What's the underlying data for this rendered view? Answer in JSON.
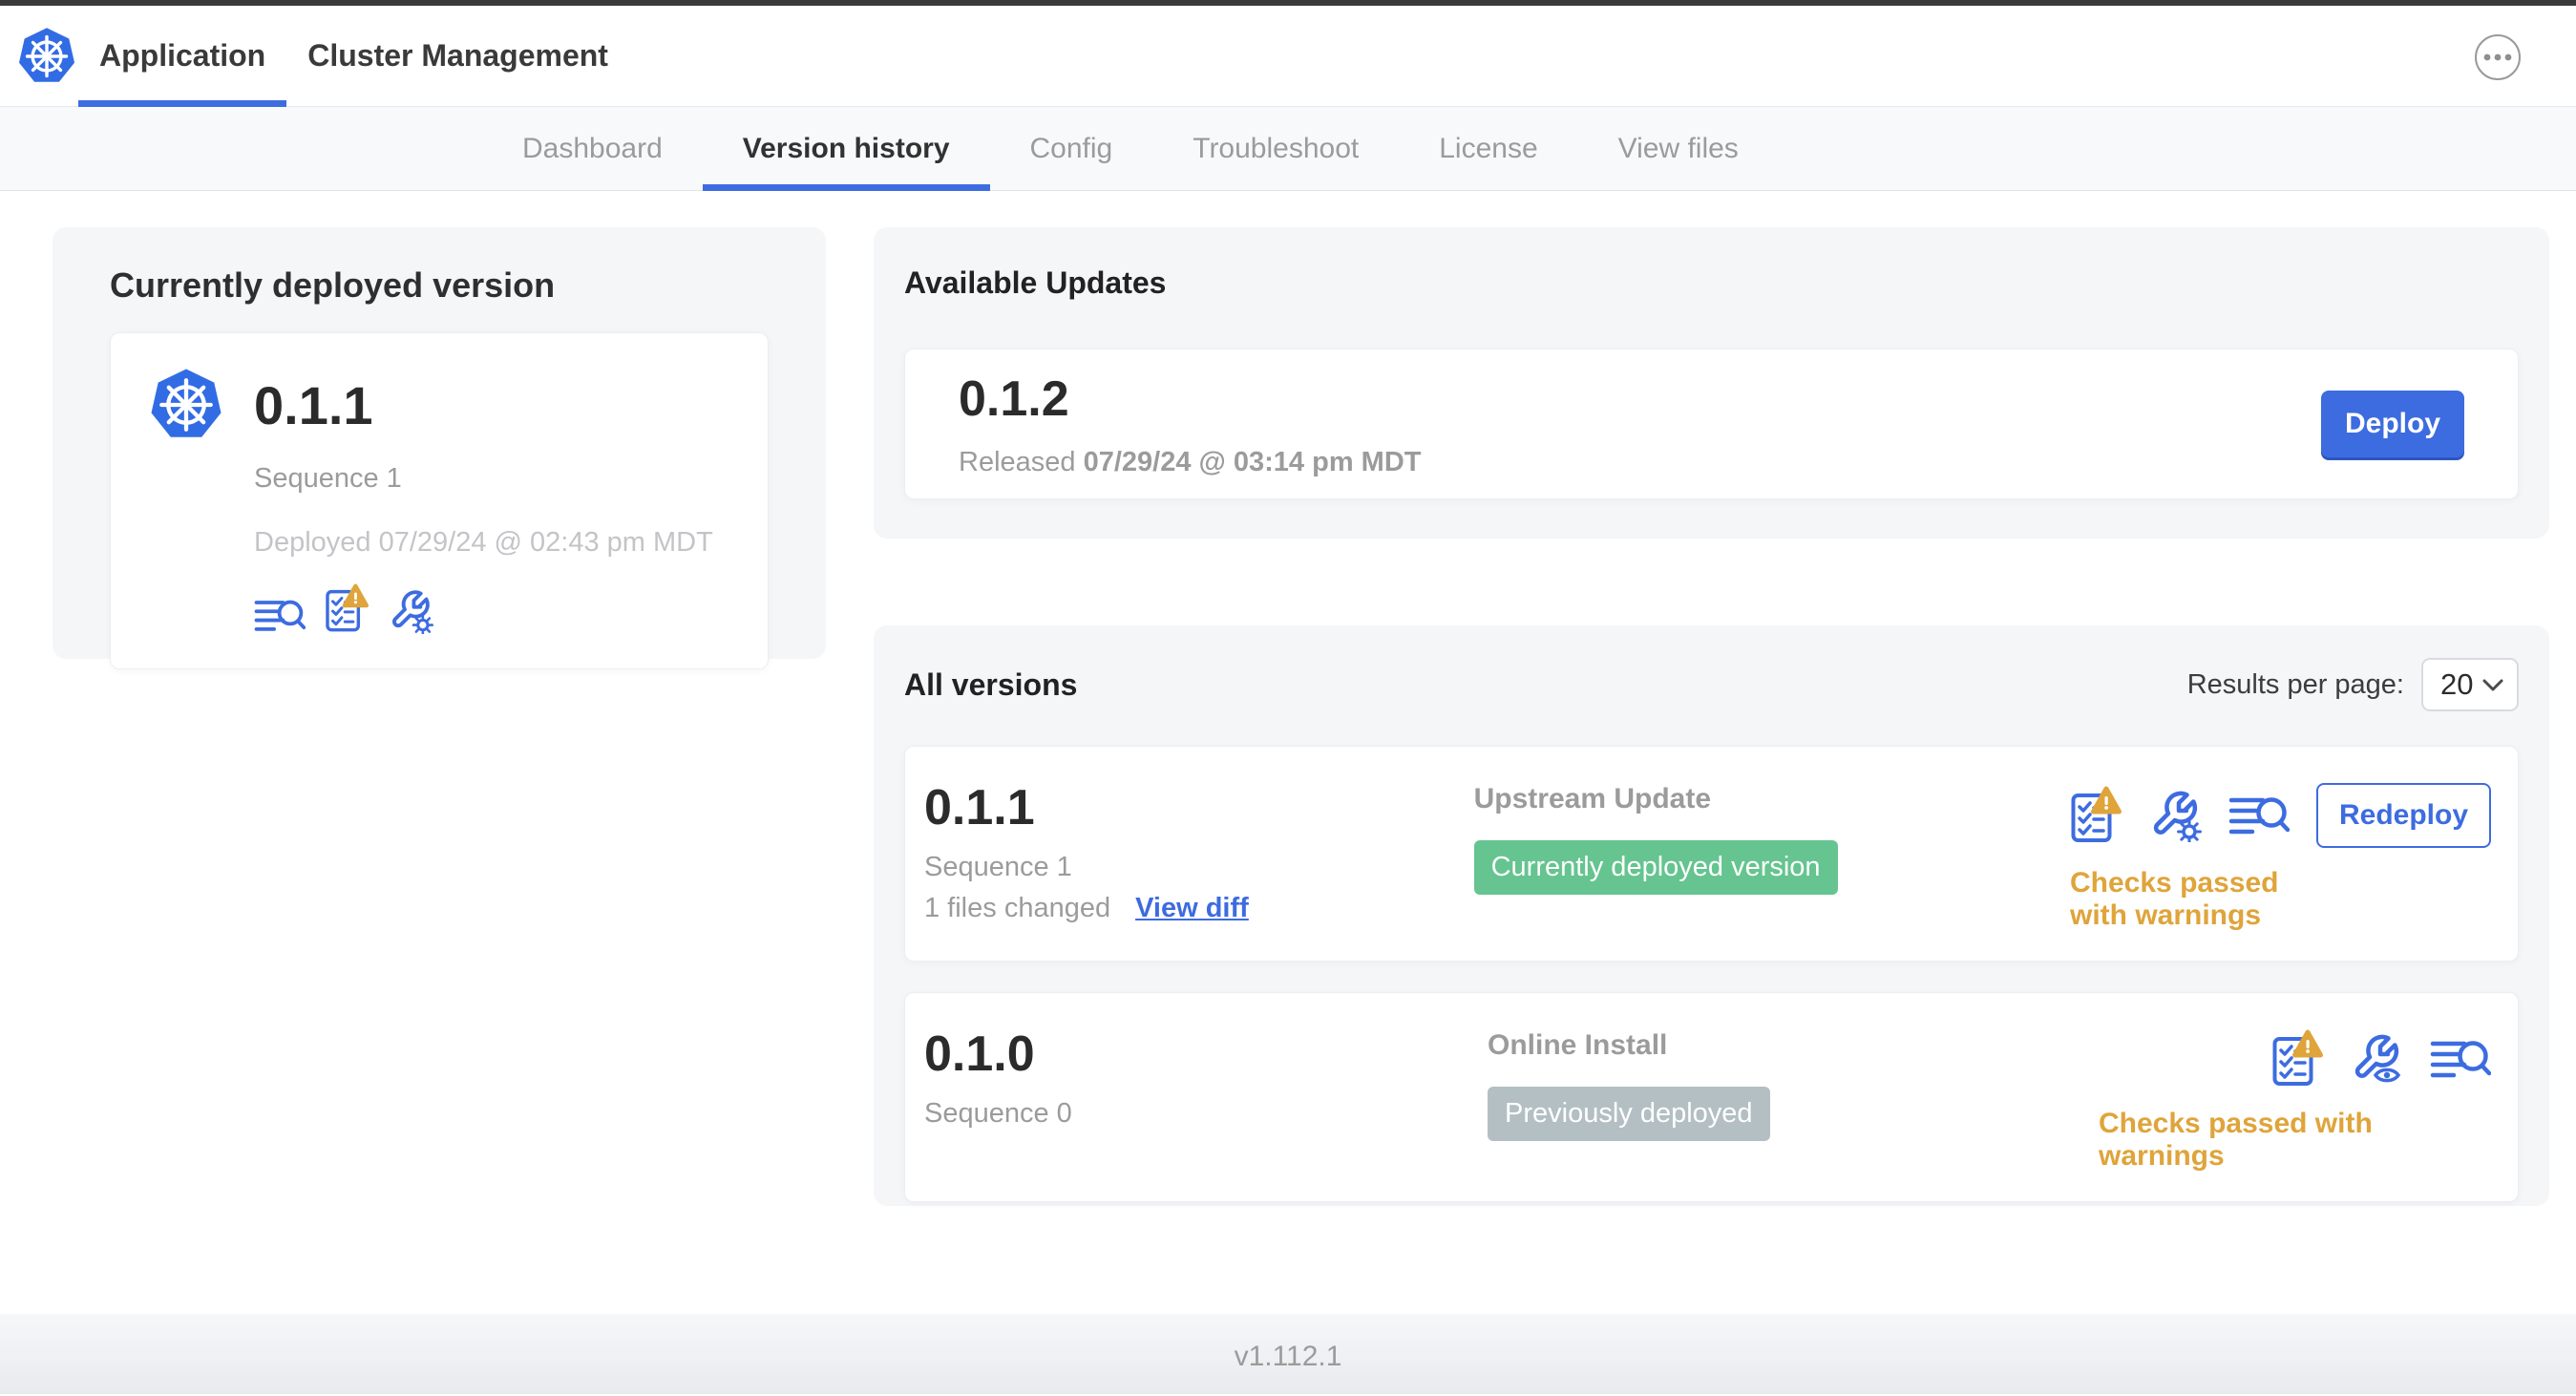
{
  "colors": {
    "accent": "#3d6ce0",
    "k8s-blue": "#326ce5",
    "success": "#65c48f",
    "muted-badge": "#b4bfc3",
    "warning": "#dfa43a",
    "text-dark": "#323232",
    "text-gray": "#9b9b9b",
    "text-faint": "#c4c4c8",
    "card-bg": "#f5f6f8",
    "subnav-bg": "#f8f9fb",
    "border": "#e7e8ec"
  },
  "header": {
    "tabs": [
      {
        "label": "Application",
        "active": true
      },
      {
        "label": "Cluster Management",
        "active": false
      }
    ],
    "more_menu_icon": "ellipsis-in-circle"
  },
  "subnav": {
    "items": [
      "Dashboard",
      "Version history",
      "Config",
      "Troubleshoot",
      "License",
      "View files"
    ],
    "active": "Version history"
  },
  "current_version": {
    "title": "Currently deployed version",
    "app_icon": "kubernetes-logo",
    "version": "0.1.1",
    "sequence": "Sequence 1",
    "deployed_at": "Deployed 07/29/24 @ 02:43 pm MDT",
    "icons": [
      "release-notes",
      "preflight-checks-warning",
      "edit-config"
    ]
  },
  "available_updates": {
    "title": "Available Updates",
    "version": "0.1.2",
    "released_prefix": "Released ",
    "released_date": "07/29/24 @ 03:14 pm MDT",
    "deploy_label": "Deploy"
  },
  "all_versions": {
    "title": "All versions",
    "results_per_page_label": "Results per page:",
    "results_per_page_value": "20",
    "rows": [
      {
        "version": "0.1.1",
        "sequence": "Sequence 1",
        "files_changed": "1 files changed",
        "view_diff_label": "View diff",
        "source": "Upstream Update",
        "badge": "Currently deployed version",
        "badge_color": "#65c48f",
        "icons": [
          "preflight-checks-warning",
          "edit-config",
          "release-notes"
        ],
        "status": "Checks passed with warnings",
        "action_label": "Redeploy"
      },
      {
        "version": "0.1.0",
        "sequence": "Sequence 0",
        "source": "Online Install",
        "badge": "Previously deployed",
        "badge_color": "#b4bfc3",
        "icons": [
          "preflight-checks-warning",
          "view-config",
          "release-notes"
        ],
        "status": "Checks passed with warnings"
      }
    ]
  },
  "footer": {
    "version_label": "v1.112.1"
  }
}
